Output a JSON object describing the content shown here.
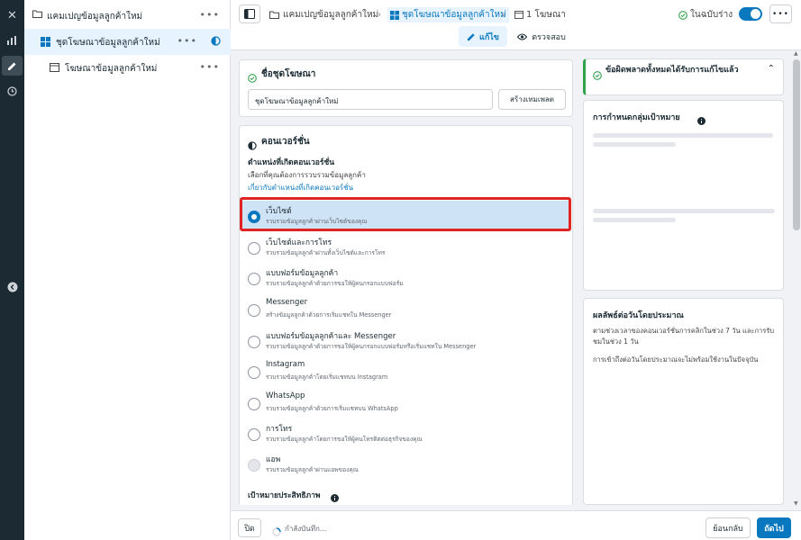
{
  "tree": {
    "campaign_label": "แคมเปญข้อมูลลูกค้าใหม่",
    "adset_label": "ชุดโฆษณาข้อมูลลูกค้าใหม่",
    "ad_label": "โฆษณาข้อมูลลูกค้าใหม่",
    "more": "•••"
  },
  "topbar": {
    "crumb_campaign": "แคมเปญข้อมูลลูกค้าใหม่",
    "crumb_adset": "ชุดโฆษณาข้อมูลลูกค้าใหม่",
    "crumb_ad": "1 โฆษณา",
    "status": "ในฉบับร่าง",
    "more": "•••",
    "tab_edit": "แก้ไข",
    "tab_review": "ตรวจสอบ"
  },
  "adset_name": {
    "title": "ชื่อชุดโฆษณา",
    "value": "ชุดโฆษณาข้อมูลลูกค้าใหม่",
    "template_button": "สร้างเทมเพลต"
  },
  "conversion": {
    "title": "คอนเวอร์ชั่น",
    "location_heading": "ตำแหน่งที่เกิดคอนเวอร์ชั่น",
    "location_desc": "เลือกที่คุณต้องการรวบรวมข้อมูลลูกค้า",
    "location_link": "เกี่ยวกับตำแหน่งที่เกิดคอนเวอร์ชั่น",
    "options": [
      {
        "title": "เว็บไซต์",
        "sub": "รวบรวมข้อมูลลูกค้าผ่านเว็บไซต์ของคุณ",
        "selected": true
      },
      {
        "title": "เว็บไซต์และการโทร",
        "sub": "รวบรวมข้อมูลลูกค้าผ่านทั้งเว็บไซต์และการโทร"
      },
      {
        "title": "แบบฟอร์มข้อมูลลูกค้า",
        "sub": "รวบรวมข้อมูลลูกค้าด้วยการขอให้ผู้คนกรอกแบบฟอร์ม"
      },
      {
        "title": "Messenger",
        "sub": "สร้างข้อมูลลูกค้าด้วยการเริ่มแชทใน Messenger"
      },
      {
        "title": "แบบฟอร์มข้อมูลลูกค้าและ Messenger",
        "sub": "รวบรวมข้อมูลลูกค้าด้วยการขอให้ผู้คนกรอกแบบฟอร์มหรือเริ่มแชทใน Messenger"
      },
      {
        "title": "Instagram",
        "sub": "รวบรวมข้อมูลลูกค้าโดยเริ่มแชทบน Instagram"
      },
      {
        "title": "WhatsApp",
        "sub": "รวบรวมข้อมูลลูกค้าด้วยการเริ่มแชทบน WhatsApp"
      },
      {
        "title": "การโทร",
        "sub": "รวบรวมข้อมูลลูกค้าโดยการขอให้ผู้คนโทรติดต่อธุรกิจของคุณ"
      },
      {
        "title": "แอพ",
        "sub": "รวบรวมข้อมูลลูกค้าผ่านแอพของคุณ",
        "disabled": true
      }
    ],
    "goal_heading": "เป้าหมายประสิทธิภาพ"
  },
  "right": {
    "errors_title": "ข้อผิดพลาดทั้งหมดได้รับการแก้ไขแล้ว",
    "audience_title": "การกำหนดกลุ่มเป้าหมาย",
    "results_title": "ผลลัพธ์ต่อวันโดยประมาณ",
    "results_text1": "ตามช่วงเวลาของคอนเวอร์ชั่นการคลิกในช่วง 7 วัน และการรับชมในช่วง 1 วัน",
    "results_text2": "การเข้าถึงต่อวันโดยประมาณจะไม่พร้อมใช้งานในปัจจุบัน"
  },
  "bottom": {
    "close": "ปิด",
    "saving": "กำลังบันทึก...",
    "back": "ย้อนกลับ",
    "next": "ถัดไป"
  },
  "colors": {
    "rail": "#1c2b33",
    "accent": "#0a78be",
    "highlight": "#e02424",
    "success": "#31a24c"
  }
}
